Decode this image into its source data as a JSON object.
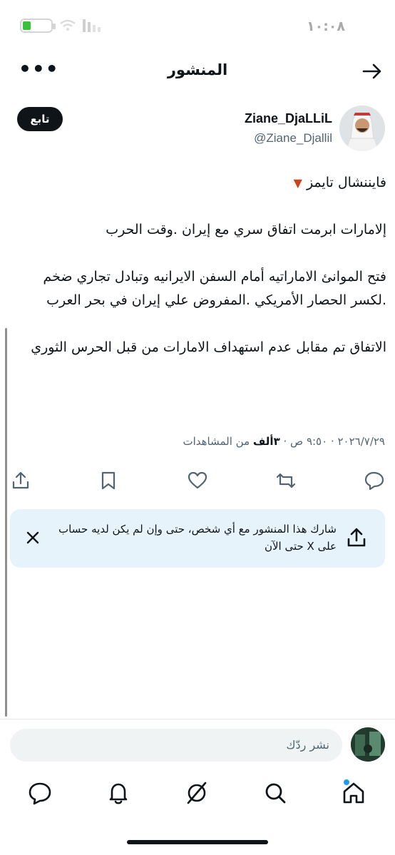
{
  "status_bar": {
    "time": "١٠:٠٨",
    "battery_level": 0.3
  },
  "header": {
    "title": "المنشور",
    "more_icon": "more-horizontal-icon",
    "back_icon": "arrow-right-icon"
  },
  "author": {
    "name": "Ziane_DjaLLiL",
    "handle": "@Ziane_Djallil",
    "follow_label": "تابع"
  },
  "tweet": {
    "source_line": "فايننشال تايمز",
    "paragraphs": [
      "إلامارات ابرمت اتفاق سري  مع إيران .وقت الحرب",
      "فتح الموانئ الاماراتيه أمام السفن الايرانيه  وتبادل تجاري ضخم .لكسر الحصار الأمريكي .المفروض علي إيران في بحر العرب",
      "الاتفاق تم مقابل عدم استهداف الامارات من قبل الحرس الثوري"
    ]
  },
  "meta": {
    "date_time": "٢٠٢٦/٧/٢٩ · ٩:٥٠ ص · ",
    "views_count": "٣ألف",
    "views_label": " من المشاهدات"
  },
  "actions": [
    "reply-icon",
    "retweet-icon",
    "like-icon",
    "bookmark-icon",
    "share-icon"
  ],
  "share_card": {
    "text": "شارك هذا المنشور مع أي شخص، حتى وإن لم يكن لديه حساب على X حتى الآن"
  },
  "reply": {
    "placeholder": "نشر ردّك"
  },
  "tab_bar": [
    "home-icon",
    "search-icon",
    "grok-icon",
    "notifications-icon",
    "messages-icon"
  ],
  "colors": {
    "accent": "#1d9bf0",
    "text": "#0f1419",
    "muted": "#536471",
    "share_card_bg": "#e6f3fb"
  }
}
